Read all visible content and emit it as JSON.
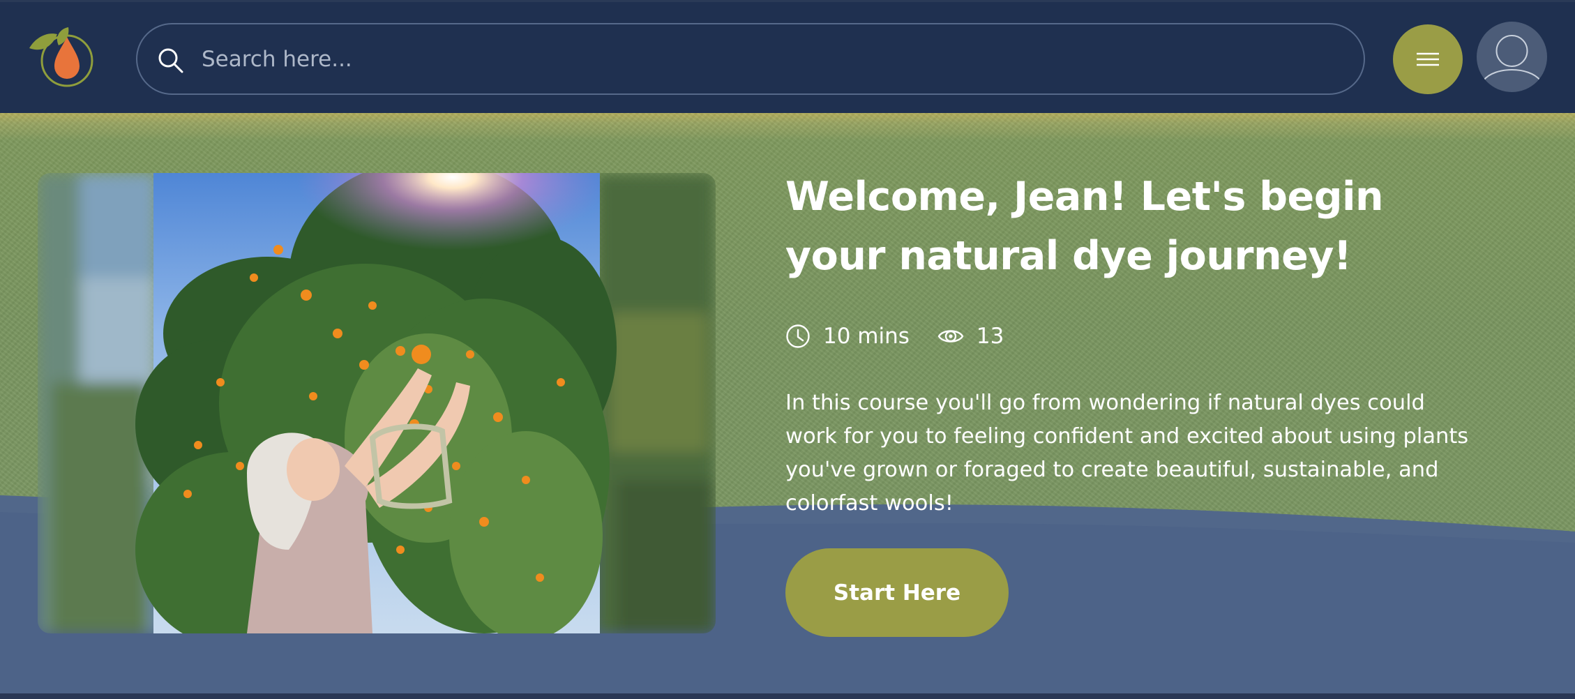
{
  "header": {
    "logo_icon": "leaf-drop-logo-icon",
    "search": {
      "placeholder": "Search here...",
      "value": "",
      "icon": "search-icon"
    },
    "menu_icon": "hamburger-menu-icon",
    "avatar_icon": "user-avatar-icon"
  },
  "hero": {
    "image_description_icon": "hero-photo",
    "title": "Welcome, Jean! Let's begin your natural dye journey!",
    "meta": {
      "duration": {
        "icon": "clock-icon",
        "label": "10 mins"
      },
      "views": {
        "icon": "eye-icon",
        "label": "13"
      }
    },
    "description": "In this course you'll go from wondering if natural dyes could work for you to feeling confident and excited about using plants you've grown or foraged to create beautiful, sustainable, and colorfast wools!",
    "cta_label": "Start Here"
  },
  "colors": {
    "navbar": "#1f3050",
    "accent_olive": "#9a9d46",
    "logo_orange": "#e8743b",
    "logo_leaf_green": "#8f9e3c",
    "text": "#ffffff",
    "hero_green": "#7b9762",
    "hero_blue": "#4d6388"
  }
}
